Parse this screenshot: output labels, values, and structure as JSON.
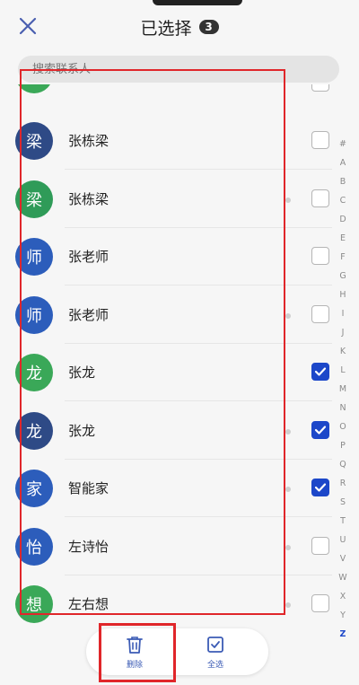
{
  "header": {
    "title": "已选择",
    "count": "3",
    "close_icon": "close-x-icon"
  },
  "search": {
    "placeholder": "搜索联系人"
  },
  "contacts": [
    {
      "avatar_char": "梁",
      "name": "张栋梁",
      "avatar_color": "#2e4a86",
      "checked": false,
      "dot": false
    },
    {
      "avatar_char": "梁",
      "name": "张栋梁",
      "avatar_color": "#2f9b58",
      "checked": false,
      "dot": true
    },
    {
      "avatar_char": "师",
      "name": "张老师",
      "avatar_color": "#2c5dbb",
      "checked": false,
      "dot": false
    },
    {
      "avatar_char": "师",
      "name": "张老师",
      "avatar_color": "#2c5dbb",
      "checked": false,
      "dot": true
    },
    {
      "avatar_char": "龙",
      "name": "张龙",
      "avatar_color": "#3aa858",
      "checked": true,
      "dot": false
    },
    {
      "avatar_char": "龙",
      "name": "张龙",
      "avatar_color": "#2e4a86",
      "checked": true,
      "dot": true
    },
    {
      "avatar_char": "家",
      "name": "智能家",
      "avatar_color": "#2c5dbb",
      "checked": true,
      "dot": true
    },
    {
      "avatar_char": "怡",
      "name": "左诗怡",
      "avatar_color": "#2c5dbb",
      "checked": false,
      "dot": true
    },
    {
      "avatar_char": "想",
      "name": "左右想",
      "avatar_color": "#3aa858",
      "checked": false,
      "dot": true
    }
  ],
  "index_letters": [
    "#",
    "A",
    "B",
    "C",
    "D",
    "E",
    "F",
    "G",
    "H",
    "I",
    "J",
    "K",
    "L",
    "M",
    "N",
    "O",
    "P",
    "Q",
    "R",
    "S",
    "T",
    "U",
    "V",
    "W",
    "X",
    "Y",
    "Z"
  ],
  "bottom_bar": {
    "delete_label": "删除",
    "select_all_label": "全选",
    "delete_icon": "trash-icon",
    "select_all_icon": "select-all-icon"
  },
  "colors": {
    "accent": "#1c47c9",
    "highlight": "#e0262a"
  }
}
